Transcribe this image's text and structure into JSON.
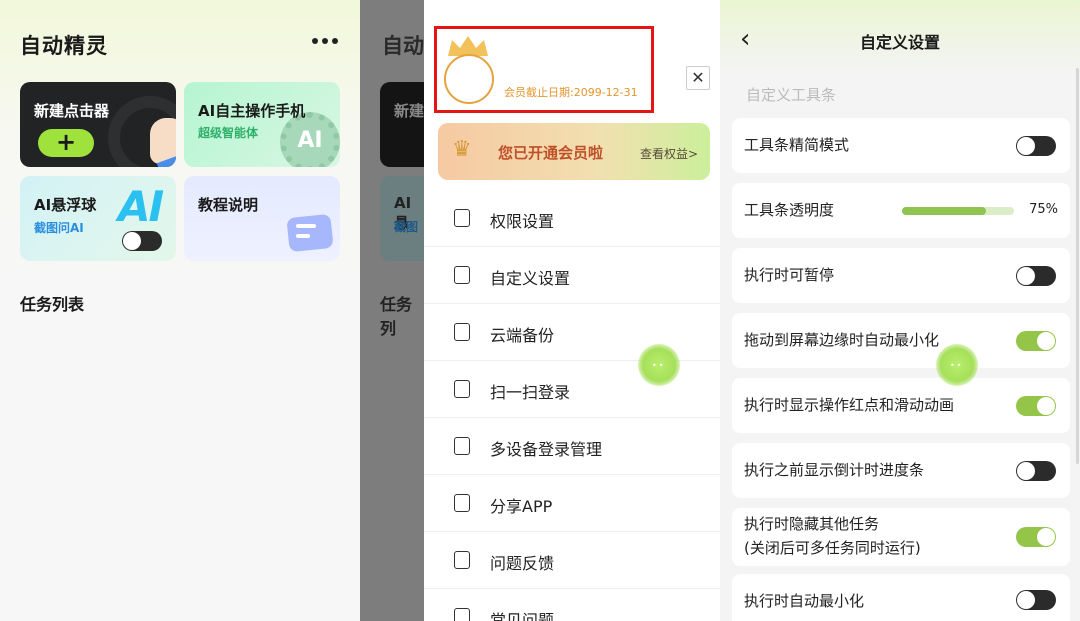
{
  "home": {
    "app_title": "自动精灵",
    "cards": {
      "new_clicker": "新建点击器",
      "new_clicker_plus": "+",
      "ai_operate": "AI自主操作手机",
      "ai_operate_sub": "超级智能体",
      "ai_badge": "AI",
      "ai_float": "AI悬浮球",
      "ai_float_sub": "截图问AI",
      "ai_float_big": "AI",
      "tutorial": "教程说明"
    },
    "task_list": "任务列表"
  },
  "drawer": {
    "bg_title": "自动",
    "bg_card1": "新建",
    "bg_card2": "AI悬",
    "bg_card2_sub": "截图",
    "bg_tasks": "任务列",
    "expire_text": "会员截止日期:2099-12-31",
    "close": "✕",
    "vip_text": "您已开通会员啦",
    "vip_more": "查看权益>",
    "vip_crown": "♛",
    "menu": [
      {
        "label": "权限设置",
        "icon": "shield-icon"
      },
      {
        "label": "自定义设置",
        "icon": "custom-settings-icon"
      },
      {
        "label": "云端备份",
        "icon": "cloud-backup-icon"
      },
      {
        "label": "扫一扫登录",
        "icon": "scan-icon"
      },
      {
        "label": "多设备登录管理",
        "icon": "devices-icon"
      },
      {
        "label": "分享APP",
        "icon": "share-icon"
      },
      {
        "label": "问题反馈",
        "icon": "feedback-icon"
      },
      {
        "label": "常见问题",
        "icon": "faq-icon"
      }
    ]
  },
  "settings": {
    "back": "‹",
    "title": "自定义设置",
    "section": "自定义工具条",
    "opacity_value": "75%",
    "opacity_fraction": 0.75,
    "rows": [
      {
        "label": "工具条精简模式",
        "on": false
      },
      {
        "label": "工具条透明度"
      },
      {
        "label": "执行时可暂停",
        "on": false
      },
      {
        "label": "拖动到屏幕边缘时自动最小化",
        "on": true
      },
      {
        "label": "执行时显示操作红点和滑动动画",
        "on": true
      },
      {
        "label": "执行之前显示倒计时进度条",
        "on": false
      },
      {
        "label": "执行时隐藏其他任务",
        "label2": "(关闭后可多任务同时运行)",
        "on": true
      },
      {
        "label": "执行时自动最小化",
        "on": false
      }
    ]
  },
  "colors": {
    "accent_green": "#95c548",
    "vip_orange": "#e3962d",
    "highlight_red": "#e31515"
  }
}
